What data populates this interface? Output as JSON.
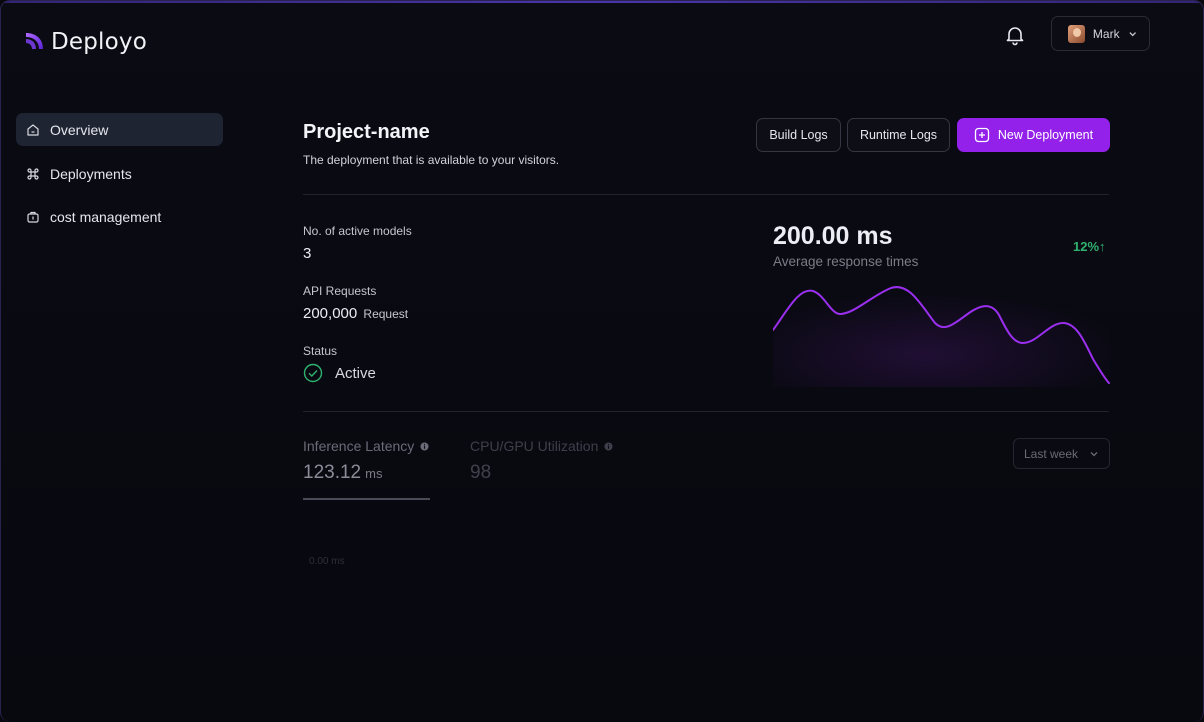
{
  "app": {
    "name": "Deployo"
  },
  "user": {
    "name": "Mark"
  },
  "sidebar": {
    "items": [
      {
        "label": "Overview",
        "icon": "home-icon",
        "active": true
      },
      {
        "label": "Deployments",
        "icon": "command-icon",
        "active": false
      },
      {
        "label": "cost management",
        "icon": "wallet-icon",
        "active": false
      }
    ]
  },
  "project": {
    "title": "Project-name",
    "subtitle": "The deployment that is available to your visitors."
  },
  "actions": {
    "build_logs": "Build Logs",
    "runtime_logs": "Runtime Logs",
    "new_deployment": "New Deployment"
  },
  "stats": {
    "active_models_label": "No. of active models",
    "active_models_value": "3",
    "api_requests_label": "API Requests",
    "api_requests_value": "200,000",
    "api_requests_unit": "Request",
    "status_label": "Status",
    "status_value": "Active"
  },
  "response_chart": {
    "value": "200.00 ms",
    "caption": "Average response times",
    "trend": "12%↑",
    "trend_color": "#2fb26f",
    "line_color": "#9b2ff0"
  },
  "metrics_tabs": [
    {
      "label": "Inference Latency",
      "value": "123.12",
      "unit": "ms",
      "selected": true
    },
    {
      "label": "CPU/GPU Utilization",
      "value": "98",
      "unit": "",
      "selected": false
    }
  ],
  "range_select": {
    "value": "Last week"
  },
  "latency_chart": {
    "axis_label": "0.00 ms"
  },
  "colors": {
    "accent": "#9321ea",
    "background": "#07070c",
    "success": "#2fb26f"
  }
}
